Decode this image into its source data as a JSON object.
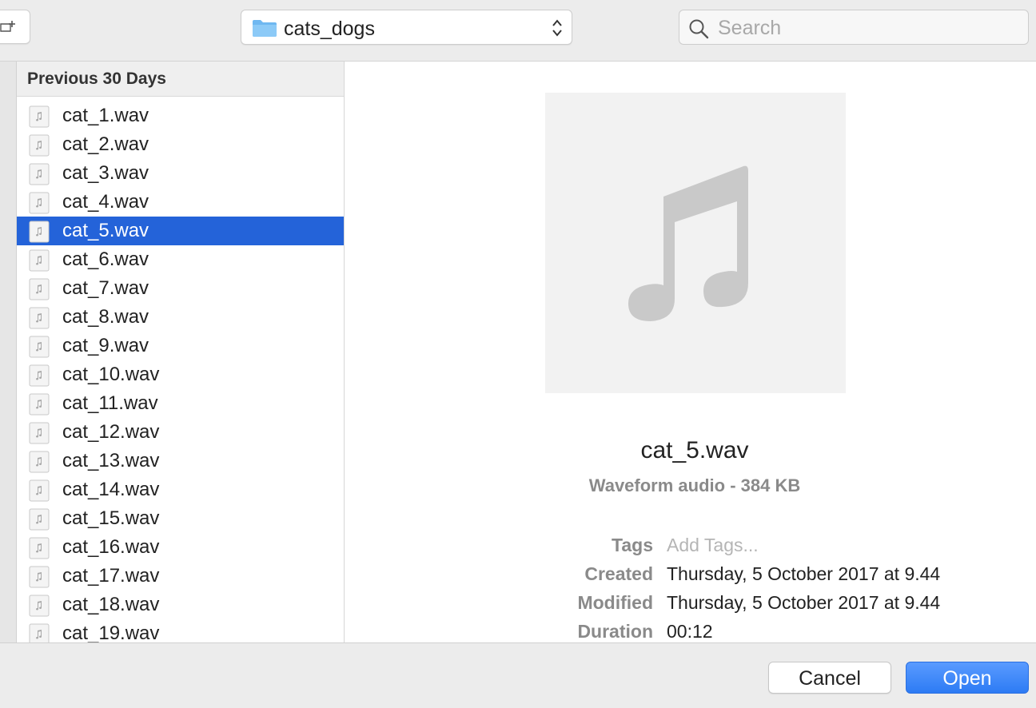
{
  "toolbar": {
    "location": "cats_dogs",
    "search_placeholder": "Search"
  },
  "file_list": {
    "section_header": "Previous 30 Days",
    "files": [
      "cat_1.wav",
      "cat_2.wav",
      "cat_3.wav",
      "cat_4.wav",
      "cat_5.wav",
      "cat_6.wav",
      "cat_7.wav",
      "cat_8.wav",
      "cat_9.wav",
      "cat_10.wav",
      "cat_11.wav",
      "cat_12.wav",
      "cat_13.wav",
      "cat_14.wav",
      "cat_15.wav",
      "cat_16.wav",
      "cat_17.wav",
      "cat_18.wav",
      "cat_19.wav"
    ],
    "selected": "cat_5.wav"
  },
  "preview": {
    "name": "cat_5.wav",
    "kind": "Waveform audio - 384 KB",
    "tags_label": "Tags",
    "tags_placeholder": "Add Tags...",
    "created_label": "Created",
    "created_value": "Thursday, 5 October 2017 at 9.44",
    "modified_label": "Modified",
    "modified_value": "Thursday, 5 October 2017 at 9.44",
    "duration_label": "Duration",
    "duration_value": "00:12"
  },
  "buttons": {
    "cancel": "Cancel",
    "open": "Open"
  },
  "colors": {
    "selection": "#2463d9",
    "primary_button": "#2d7bf4",
    "folder": "#6fb8f1"
  },
  "icons": {
    "new_folder": "new-folder-icon",
    "location": "folder-icon",
    "popup": "up-down-chevron-icon",
    "search": "search-icon",
    "file": "audio-file-icon",
    "preview": "music-note-icon"
  }
}
